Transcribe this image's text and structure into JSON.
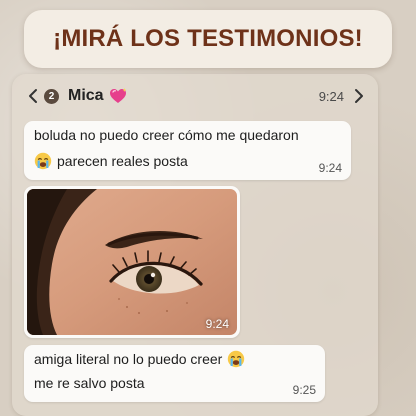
{
  "banner": {
    "title": "¡MIRÁ LOS TESTIMONIOS!"
  },
  "chat_header": {
    "unread_count": "2",
    "contact_name": "Mica",
    "contact_emoji": "sparkling-heart-icon",
    "time": "9:24",
    "back_icon": "chevron-left-icon",
    "forward_icon": "chevron-right-icon"
  },
  "messages": [
    {
      "type": "text",
      "lines": [
        "boluda no puedo creer cómo me quedaron",
        "parecen reales posta"
      ],
      "line2_emoji": "crying-face-icon",
      "time": "9:24"
    },
    {
      "type": "photo",
      "image": "close-up photo of an eye and eyebrow",
      "time": "9:24"
    },
    {
      "type": "text",
      "lines": [
        "amiga literal no lo puedo creer",
        "me re salvo posta"
      ],
      "line1_emoji": "crying-face-icon",
      "time": "9:25"
    }
  ],
  "colors": {
    "banner_text": "#6e3219",
    "background": "#d8cfc3",
    "bubble": "#fbfaf8"
  }
}
